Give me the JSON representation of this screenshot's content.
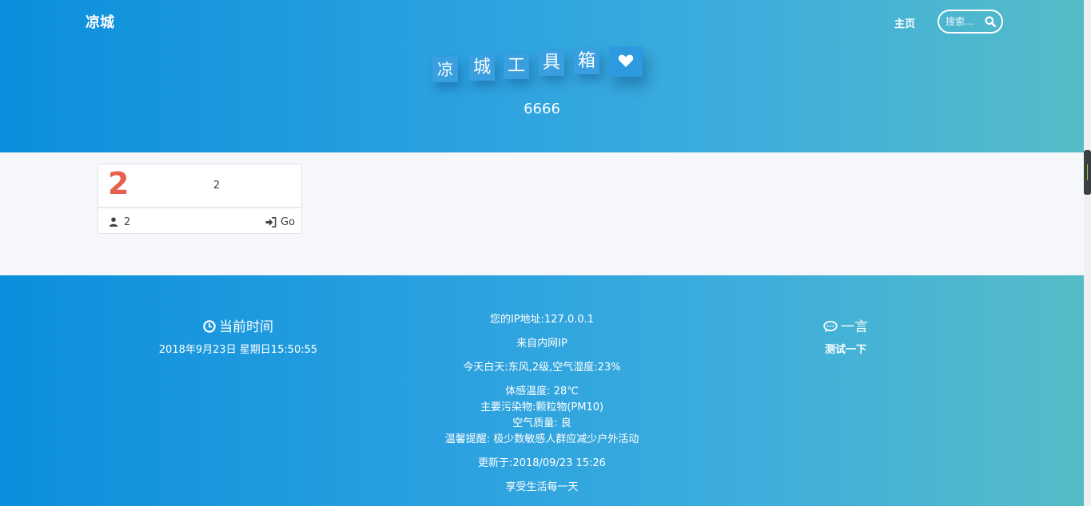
{
  "header": {
    "brand": "凉城",
    "nav_home": "主页",
    "search_placeholder": "搜索...",
    "title_chars": [
      "凉",
      "城",
      "工",
      "具",
      "箱"
    ],
    "subtitle": "6666"
  },
  "card": {
    "number": "2",
    "text": "2",
    "author": "2",
    "go_label": "Go"
  },
  "footer": {
    "time_title": "当前时间",
    "time_value": "2018年9月23日 星期日15:50:55",
    "ip_line": "您的IP地址:127.0.0.1",
    "source_line": "来自内网IP",
    "weather_line": "今天白天:东风,2级,空气湿度:23%",
    "feel_line": "体感温度: 28℃",
    "pollutant_line": "主要污染物:颗粒物(PM10)",
    "air_quality_line": "空气质量: 良",
    "tip_line": "温馨提醒: 极少数敏感人群应减少户外活动",
    "updated_line": "更新于:2018/09/23  15:26",
    "motto": "享受生活每一天",
    "quote_title": "一言",
    "quote_text": "测试一下"
  },
  "colors": {
    "gradient_start": "#0b8fdc",
    "gradient_end": "#55bcc7",
    "card_number": "#e8604c",
    "page_background": "#f6f7fb"
  },
  "icons": {
    "search": "search-icon",
    "heart": "heart-icon",
    "user": "user-icon",
    "go": "sign-in-icon",
    "clock": "clock-icon",
    "quote": "comment-icon"
  }
}
